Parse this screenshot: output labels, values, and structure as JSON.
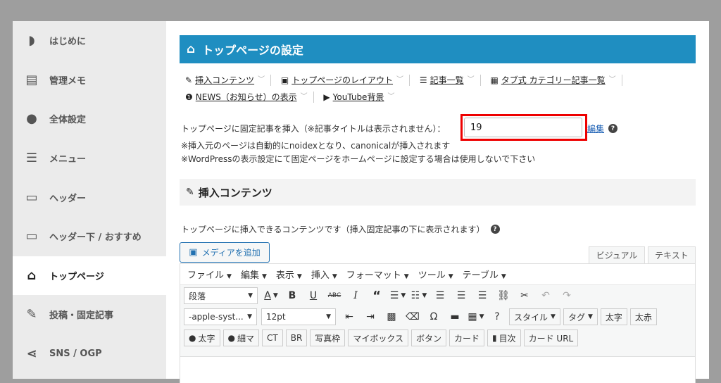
{
  "sidebar": {
    "items": [
      {
        "label": "はじめに",
        "icon": "book-icon",
        "glyph": "◗"
      },
      {
        "label": "管理メモ",
        "icon": "memo-icon",
        "glyph": "▤"
      },
      {
        "label": "全体設定",
        "icon": "palette-icon",
        "glyph": "●"
      },
      {
        "label": "メニュー",
        "icon": "menu-icon",
        "glyph": "☰"
      },
      {
        "label": "ヘッダー",
        "icon": "header-icon",
        "glyph": "▭"
      },
      {
        "label": "ヘッダー下 / おすすめ",
        "icon": "header-below-icon",
        "glyph": "▭"
      },
      {
        "label": "トップページ",
        "icon": "home-icon",
        "glyph": "⌂"
      },
      {
        "label": "投稿・固定記事",
        "icon": "edit-icon",
        "glyph": "✎"
      },
      {
        "label": "SNS / OGP",
        "icon": "share-icon",
        "glyph": "⋖"
      }
    ],
    "active_index": 6
  },
  "header": {
    "title": "トップページの設定",
    "icon": "home-icon"
  },
  "tabs": [
    {
      "label": "挿入コンテンツ",
      "icon": "edit-icon",
      "glyph": "✎"
    },
    {
      "label": "トップページのレイアウト",
      "icon": "layout-icon",
      "glyph": "▣"
    },
    {
      "label": "記事一覧",
      "icon": "list-icon",
      "glyph": "☰"
    },
    {
      "label": "タブ式 カテゴリー記事一覧",
      "icon": "grid-icon",
      "glyph": "▦"
    },
    {
      "label": "NEWS（お知らせ）の表示",
      "icon": "info-icon",
      "glyph": "❶"
    },
    {
      "label": "YouTube背景",
      "icon": "youtube-icon",
      "glyph": "▶"
    }
  ],
  "fixed": {
    "label": "トップページに固定記事を挿入（※記事タイトルは表示されません）：",
    "value": "19",
    "edit_link": "編集",
    "help": "?"
  },
  "notes": [
    "※挿入元のページは自動的にnoidexとなり、canonicalが挿入されます",
    "※WordPressの表示設定にて固定ページをホームページに設定する場合は使用しないで下さい"
  ],
  "section": {
    "title": "挿入コンテンツ"
  },
  "desc": "トップページに挿入できるコンテンツです（挿入固定記事の下に表示されます）",
  "media_button": "メディアを追加",
  "mode_tabs": {
    "visual": "ビジュアル",
    "text": "テキスト"
  },
  "menubar": [
    "ファイル",
    "編集",
    "表示",
    "挿入",
    "フォーマット",
    "ツール",
    "テーブル"
  ],
  "toolbar": {
    "paragraph": "段落",
    "font": "-apple-syst...",
    "size": "12pt",
    "style": "スタイル",
    "tag": "タグ",
    "bold_jp": "太字",
    "bold_red": "太赤",
    "row3": [
      "太字",
      "細マ",
      "CT",
      "BR",
      "写真枠",
      "マイボックス",
      "ボタン",
      "カード",
      "目次",
      "カード URL"
    ]
  },
  "colors": {
    "accent": "#1f8ec1",
    "highlight": "#ee0000",
    "link": "#1a5fb4"
  }
}
